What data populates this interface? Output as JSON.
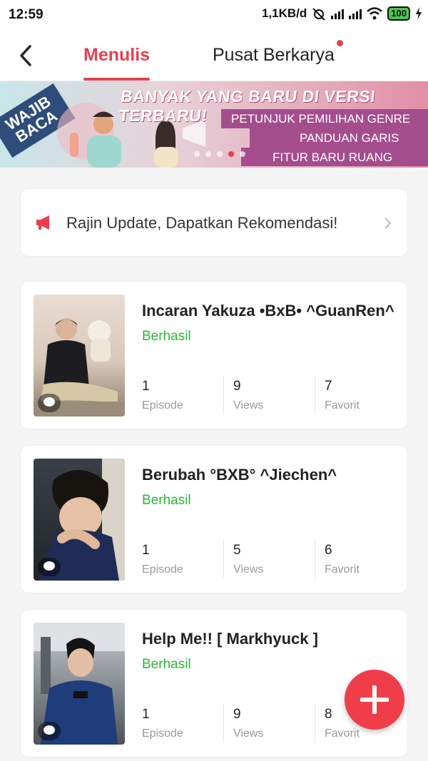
{
  "status_bar": {
    "time": "12:59",
    "network_speed": "1,1KB/d",
    "battery": "100"
  },
  "header": {
    "tabs": [
      {
        "label": "Menulis",
        "active": true
      },
      {
        "label": "Pusat Berkarya",
        "active": false,
        "has_dot": true
      }
    ]
  },
  "banner": {
    "tag_line1": "WAJIB",
    "tag_line2": "BACA",
    "headline": "BANYAK YANG BARU DI VERSI TERBARU!",
    "items": [
      "PETUNJUK PEMILIHAN GENRE",
      "PANDUAN GARIS BESAR",
      "FITUR BARU RUANG MENULIS"
    ],
    "page_count": 5,
    "active_page": 4
  },
  "notice": {
    "text": "Rajin Update, Dapatkan Rekomendasi!"
  },
  "stories": [
    {
      "title": "Incaran Yakuza •BxB• ^GuanRen^",
      "status": "Berhasil",
      "episode": "1",
      "episode_label": "Episode",
      "views": "9",
      "views_label": "Views",
      "favorit": "7",
      "favorit_label": "Favorit"
    },
    {
      "title": "Berubah °BXB° ^Jiechen^",
      "status": "Berhasil",
      "episode": "1",
      "episode_label": "Episode",
      "views": "5",
      "views_label": "Views",
      "favorit": "6",
      "favorit_label": "Favorit"
    },
    {
      "title": "Help Me!! [ Markhyuck ]",
      "status": "Berhasil",
      "episode": "1",
      "episode_label": "Episode",
      "views": "9",
      "views_label": "Views",
      "favorit": "8",
      "favorit_label": "Favorit"
    }
  ],
  "colors": {
    "accent": "#e8404f",
    "success": "#2fb33d",
    "fab": "#ef3e4a"
  },
  "icons": [
    "back-arrow-icon",
    "megaphone-icon",
    "chevron-right-icon",
    "comment-bubble-icon",
    "plus-icon"
  ]
}
